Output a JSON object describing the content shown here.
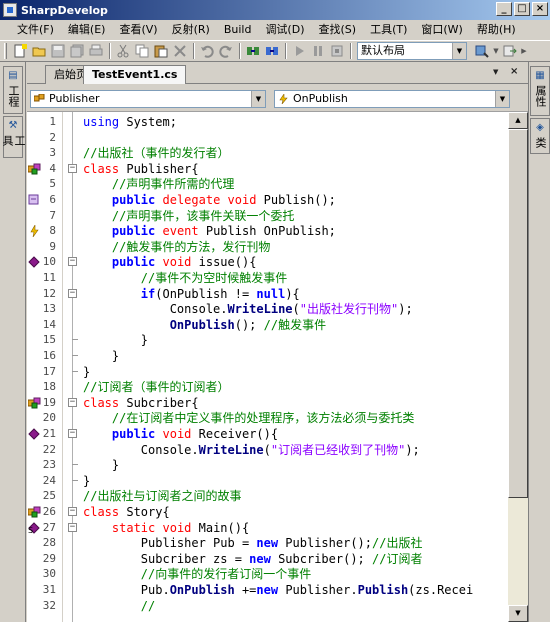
{
  "window": {
    "title": "SharpDevelop",
    "controls": [
      "_",
      "□",
      "×"
    ]
  },
  "menu": [
    "文件(F)",
    "编辑(E)",
    "查看(V)",
    "反射(R)",
    "Build",
    "调试(D)",
    "查找(S)",
    "工具(T)",
    "窗口(W)",
    "帮助(H)"
  ],
  "toolbar": {
    "layout_value": "默认布局"
  },
  "left_panel": {
    "projects_label": "工程",
    "tools_label": "工具"
  },
  "right_panel": {
    "properties_label": "属性",
    "classes_label": "类"
  },
  "tabs": {
    "start_page": "启始页",
    "file": "TestEvent1.cs",
    "close": "×"
  },
  "navigation": {
    "class_value": "Publisher",
    "member_value": "OnPublish"
  },
  "code": {
    "lines": [
      {
        "n": "1",
        "t": "using System;"
      },
      {
        "n": "2",
        "t": ""
      },
      {
        "n": "3",
        "t": "//出版社（事件的发行者）"
      },
      {
        "n": "4",
        "t": "class Publisher{"
      },
      {
        "n": "5",
        "t": "    //声明事件所需的代理"
      },
      {
        "n": "6",
        "t": "    public delegate void Publish();"
      },
      {
        "n": "7",
        "t": "    //声明事件，该事件关联一个委托"
      },
      {
        "n": "8",
        "t": "    public event Publish OnPublish;"
      },
      {
        "n": "9",
        "t": "    //触发事件的方法，发行刊物"
      },
      {
        "n": "10",
        "t": "    public void issue(){"
      },
      {
        "n": "11",
        "t": "        //事件不为空时候触发事件"
      },
      {
        "n": "12",
        "t": "        if(OnPublish != null){"
      },
      {
        "n": "13",
        "t": "            Console.WriteLine(\"出版社发行刊物\");"
      },
      {
        "n": "14",
        "t": "            OnPublish(); //触发事件"
      },
      {
        "n": "15",
        "t": "        }"
      },
      {
        "n": "16",
        "t": "    }"
      },
      {
        "n": "17",
        "t": "}"
      },
      {
        "n": "18",
        "t": "//订阅者（事件的订阅者）"
      },
      {
        "n": "19",
        "t": "class Subcriber{"
      },
      {
        "n": "20",
        "t": "    //在订阅者中定义事件的处理程序，该方法必须与委托类"
      },
      {
        "n": "21",
        "t": "    public void Receiver(){"
      },
      {
        "n": "22",
        "t": "        Console.WriteLine(\"订阅者已经收到了刊物\");"
      },
      {
        "n": "23",
        "t": "    }"
      },
      {
        "n": "24",
        "t": "}"
      },
      {
        "n": "25",
        "t": "//出版社与订阅者之间的故事"
      },
      {
        "n": "26",
        "t": "class Story{"
      },
      {
        "n": "27",
        "t": "    static void Main(){"
      },
      {
        "n": "28",
        "t": "        Publisher Pub = new Publisher();//出版社"
      },
      {
        "n": "29",
        "t": "        Subcriber zs = new Subcriber(); //订阅者"
      },
      {
        "n": "30",
        "t": "        //向事件的发行者订阅一个事件"
      },
      {
        "n": "31",
        "t": "        Pub.OnPublish +=new Publisher.Publish(zs.Recei"
      },
      {
        "n": "32",
        "t": "        //"
      }
    ]
  },
  "colors": {
    "keyword": "#0000ff",
    "declaration": "#ff0000",
    "comment": "#008000",
    "string": "#8b00ff",
    "member": "#000080",
    "titlebar": "#0a246a"
  }
}
